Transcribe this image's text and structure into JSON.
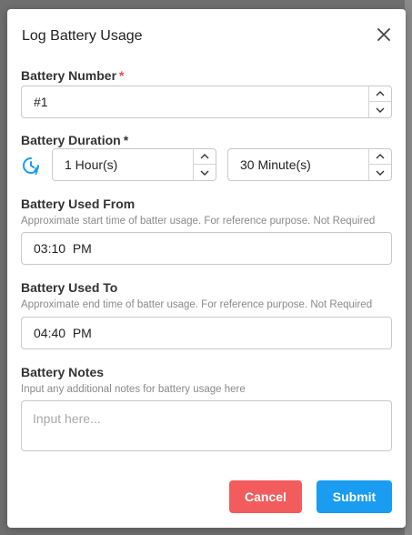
{
  "modal": {
    "title": "Log Battery Usage",
    "close_icon": "close-icon"
  },
  "battery_number": {
    "label": "Battery Number",
    "required_mark": "*",
    "value": "#1"
  },
  "battery_duration": {
    "label": "Battery Duration",
    "required_mark": "*",
    "icon": "clock-icon",
    "hours_value": "1 Hour(s)",
    "minutes_value": "30 Minute(s)"
  },
  "used_from": {
    "label": "Battery Used From",
    "help": "Approximate start time of batter usage. For reference purpose. Not Required",
    "value": "03:10  PM"
  },
  "used_to": {
    "label": "Battery Used To",
    "help": "Approximate end time of batter usage. For reference purpose. Not Required",
    "value": "04:40  PM"
  },
  "notes": {
    "label": "Battery Notes",
    "help": "Input any additional notes for battery usage here",
    "placeholder": "Input here..."
  },
  "actions": {
    "cancel_label": "Cancel",
    "submit_label": "Submit"
  },
  "colors": {
    "required": "#e5484d",
    "cancel": "#f25c5c",
    "submit": "#1a9cf0",
    "icon_accent": "#1a9cf0"
  }
}
